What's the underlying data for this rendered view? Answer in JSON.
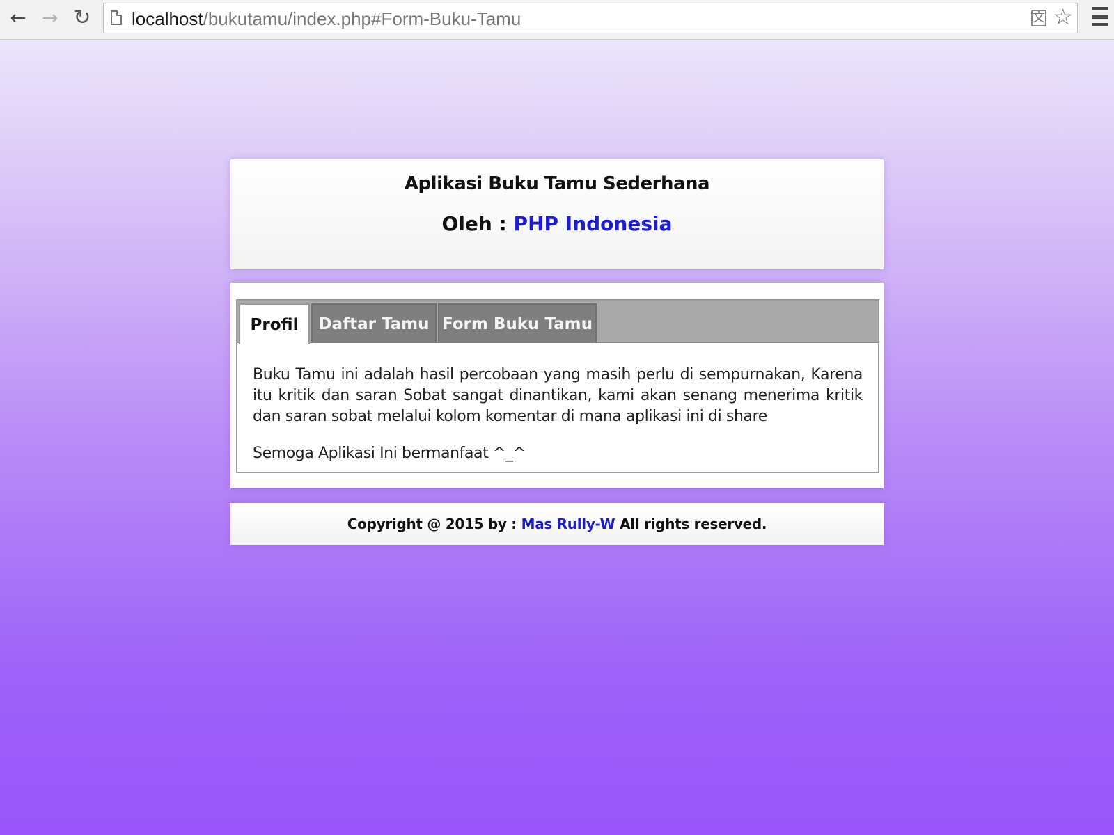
{
  "browser": {
    "url_host": "localhost",
    "url_path": "/bukutamu/index.php#Form-Buku-Tamu",
    "back_icon": "back-arrow-icon",
    "forward_icon": "forward-arrow-icon",
    "reload_icon": "reload-icon",
    "translate_icon": "translate-icon",
    "bookmark_icon": "star-icon",
    "menu_icon": "hamburger-menu-icon"
  },
  "header": {
    "title": "Aplikasi Buku Tamu Sederhana",
    "byline_prefix": "Oleh : ",
    "byline_link": "PHP Indonesia"
  },
  "tabs": [
    {
      "label": "Profil",
      "active": true
    },
    {
      "label": "Daftar Tamu",
      "active": false
    },
    {
      "label": "Form Buku Tamu",
      "active": false
    }
  ],
  "profil": {
    "paragraph1": "Buku Tamu ini adalah hasil percobaan yang masih perlu di sempurnakan, Karena itu kritik dan saran Sobat sangat dinantikan, kami akan senang menerima kritik dan saran sobat melalui kolom komentar di mana aplikasi ini di share",
    "paragraph2": "Semoga Aplikasi Ini bermanfaat ^_^"
  },
  "footer": {
    "prefix": "Copyright @ 2015 by : ",
    "author_link": "Mas Rully-W",
    "suffix": " All rights reserved."
  },
  "colors": {
    "link": "#1d1dcc",
    "tab_inactive": "#7f7f7f",
    "tab_bar": "#a9a9a9",
    "gradient_top": "#ece6fb",
    "gradient_bottom": "#9a55fb"
  }
}
